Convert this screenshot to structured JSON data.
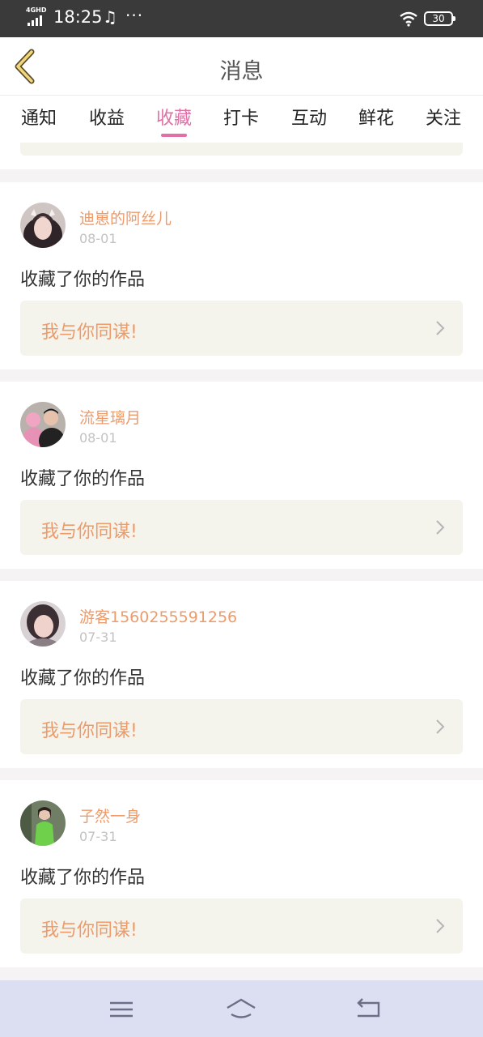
{
  "status_bar": {
    "network": "4GHD",
    "time": "18:25",
    "notification_icons": [
      "tiktok-icon"
    ],
    "more": "···",
    "battery": "30"
  },
  "header": {
    "title": "消息"
  },
  "tabs": [
    {
      "label": "通知",
      "active": false
    },
    {
      "label": "收益",
      "active": false
    },
    {
      "label": "收藏",
      "active": true
    },
    {
      "label": "打卡",
      "active": false
    },
    {
      "label": "互动",
      "active": false
    },
    {
      "label": "鲜花",
      "active": false
    },
    {
      "label": "关注",
      "active": false
    }
  ],
  "messages": [
    {
      "username": "迪崽的阿丝儿",
      "date": "08-01",
      "action": "收藏了你的作品",
      "work_title": "我与你同谋!"
    },
    {
      "username": "流星璃月",
      "date": "08-01",
      "action": "收藏了你的作品",
      "work_title": "我与你同谋!"
    },
    {
      "username": "游客1560255591256",
      "date": "07-31",
      "action": "收藏了你的作品",
      "work_title": "我与你同谋!"
    },
    {
      "username": "子然一身",
      "date": "07-31",
      "action": "收藏了你的作品",
      "work_title": "我与你同谋!"
    }
  ],
  "colors": {
    "accent": "#e26fa6",
    "username": "#ee9b69",
    "link_bg": "#f4f3ec",
    "system_nav_bg": "#dcdff2"
  }
}
